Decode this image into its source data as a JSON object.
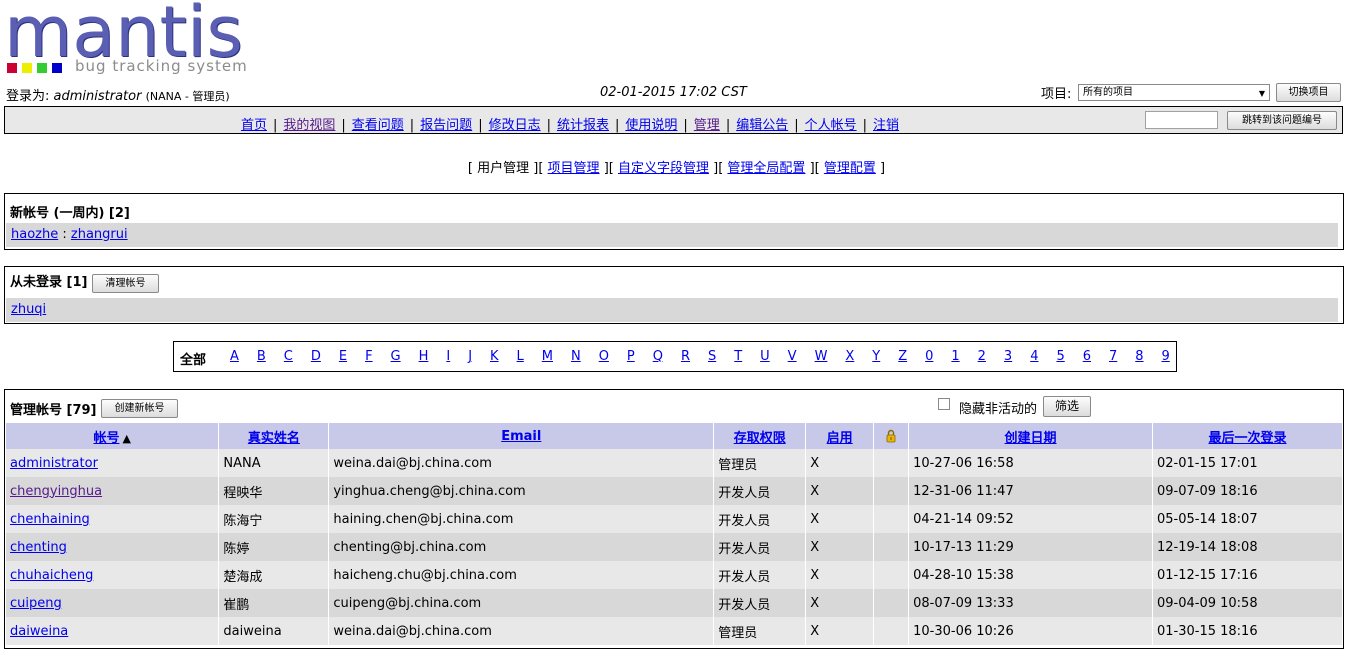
{
  "logo": {
    "word": "mantis",
    "tagline": "bug tracking system",
    "squares": [
      "#cc0033",
      "#eeee00",
      "#33cc33",
      "#0000cc"
    ]
  },
  "header": {
    "login_label": "登录为:",
    "username": "administrator",
    "role_text": "(NANA - 管理员)",
    "datetime": "02-01-2015 17:02 CST",
    "project_label": "项目:",
    "project_selected": "所有的项目",
    "switch_button": "切换项目"
  },
  "main_menu": {
    "items": [
      "首页",
      "我的视图",
      "查看问题",
      "报告问题",
      "修改日志",
      "统计报表",
      "使用说明",
      "管理",
      "编辑公告",
      "个人帐号",
      "注销"
    ],
    "separator": "|",
    "jump_value": "",
    "jump_button": "跳转到该问题编号"
  },
  "sub_menu": {
    "current": "用户管理",
    "links": [
      "项目管理",
      "自定义字段管理",
      "管理全局配置",
      "管理配置"
    ]
  },
  "new_accounts": {
    "title": "新帐号 (一周内) [2]",
    "users": [
      "haozhe",
      "zhangrui"
    ],
    "separator": ":"
  },
  "never_logged": {
    "title": "从未登录 [1]",
    "prune_button": "清理帐号",
    "users": [
      "zhuqi"
    ]
  },
  "alpha_filter": {
    "all_label": "全部",
    "letters": [
      "A",
      "B",
      "C",
      "D",
      "E",
      "F",
      "G",
      "H",
      "I",
      "J",
      "K",
      "L",
      "M",
      "N",
      "O",
      "P",
      "Q",
      "R",
      "S",
      "T",
      "U",
      "V",
      "W",
      "X",
      "Y",
      "Z",
      "0",
      "1",
      "2",
      "3",
      "4",
      "5",
      "6",
      "7",
      "8",
      "9"
    ]
  },
  "manage": {
    "title": "管理帐号 [79]",
    "create_button": "创建新帐号",
    "hide_inactive_label": "隐藏非活动的",
    "hide_inactive_checked": false,
    "filter_button": "筛选",
    "columns": [
      "帐号",
      "真实姓名",
      "Email",
      "存取权限",
      "启用",
      "",
      "创建日期",
      "最后一次登录"
    ],
    "rows": [
      {
        "username": "administrator",
        "realname": "NANA",
        "email": "weina.dai@bj.china.com",
        "access": "管理员",
        "enabled": "X",
        "protected": "",
        "created": "10-27-06 16:58",
        "last_visit": "02-01-15 17:01"
      },
      {
        "username": "chengyinghua",
        "realname": "程映华",
        "email": "yinghua.cheng@bj.china.com",
        "access": "开发人员",
        "enabled": "X",
        "protected": "",
        "created": "12-31-06 11:47",
        "last_visit": "09-07-09 18:16"
      },
      {
        "username": "chenhaining",
        "realname": "陈海宁",
        "email": "haining.chen@bj.china.com",
        "access": "开发人员",
        "enabled": "X",
        "protected": "",
        "created": "04-21-14 09:52",
        "last_visit": "05-05-14 18:07"
      },
      {
        "username": "chenting",
        "realname": "陈婷",
        "email": "chenting@bj.china.com",
        "access": "开发人员",
        "enabled": "X",
        "protected": "",
        "created": "10-17-13 11:29",
        "last_visit": "12-19-14 18:08"
      },
      {
        "username": "chuhaicheng",
        "realname": "楚海成",
        "email": "haicheng.chu@bj.china.com",
        "access": "开发人员",
        "enabled": "X",
        "protected": "",
        "created": "04-28-10 15:38",
        "last_visit": "01-12-15 17:16"
      },
      {
        "username": "cuipeng",
        "realname": "崔鹏",
        "email": "cuipeng@bj.china.com",
        "access": "开发人员",
        "enabled": "X",
        "protected": "",
        "created": "08-07-09 13:33",
        "last_visit": "09-04-09 10:58"
      },
      {
        "username": "daiweina",
        "realname": "daiweina",
        "email": "weina.dai@bj.china.com",
        "access": "管理员",
        "enabled": "X",
        "protected": "",
        "created": "10-30-06 10:26",
        "last_visit": "01-30-15 18:16"
      }
    ]
  }
}
